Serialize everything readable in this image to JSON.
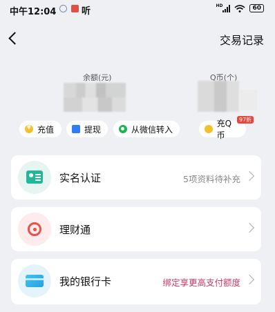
{
  "status_bar": {
    "time": "中午12:04",
    "listen": "听",
    "network": "HD",
    "battery": "60"
  },
  "header": {
    "records_link": "交易记录"
  },
  "balances": {
    "yuan_label": "余额(元)",
    "qcoin_label": "Q币(个)"
  },
  "actions": {
    "recharge": "充值",
    "withdraw": "提现",
    "wechat_transfer": "从微信转入",
    "qcoin_recharge": "充Q币",
    "discount_badge": "97折"
  },
  "list": [
    {
      "title": "实名认证",
      "subtitle": "5项资料待补充",
      "icon": "id-card-icon"
    },
    {
      "title": "理财通",
      "subtitle": "",
      "icon": "licaitong-icon"
    },
    {
      "title": "我的银行卡",
      "subtitle": "绑定享更高支付额度",
      "icon": "bank-card-icon"
    }
  ],
  "colors": {
    "background": "#eef0f3",
    "card": "#ffffff",
    "realname_icon": "#21b89a",
    "licaitong_icon": "#e8514a",
    "bankcard_icon": "#2a9fe0",
    "promo_text": "#c43d6b",
    "discount_badge": "#e8453c"
  }
}
